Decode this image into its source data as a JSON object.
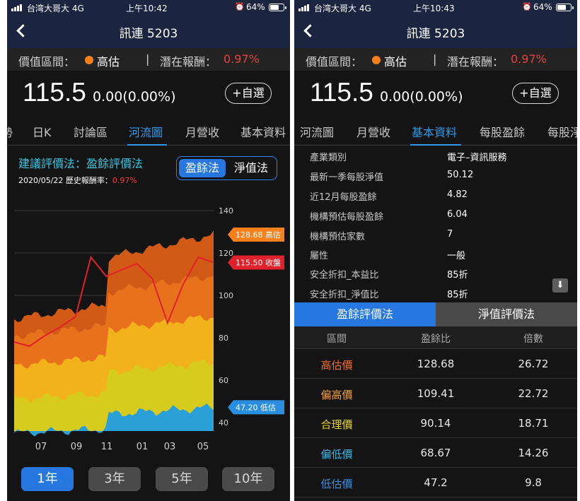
{
  "left": {
    "status": {
      "carrier": "台湾大哥大  4G",
      "time": "上午10:42",
      "battery": "64%"
    },
    "title": "訊連 5203",
    "valuation": {
      "label": "價值區間：",
      "status": "高估",
      "sep": "|",
      "potential_label": "潛在報酬：",
      "potential_value": "0.97%"
    },
    "price": "115.5",
    "change": "0.00(0.00%)",
    "fav_label": "+自選",
    "tabs": [
      "勢",
      "日K",
      "討論區",
      "河流圖",
      "月營收",
      "基本資料"
    ],
    "active_tab": "河流圖",
    "rec_label": "建議評價法：盈餘評價法",
    "rec_date": "2020/05/22 歷史報酬率：",
    "rec_rate": "0.97%",
    "seg": [
      "盈餘法",
      "淨值法"
    ],
    "range_buttons": [
      "1年",
      "3年",
      "5年",
      "10年"
    ],
    "active_range": "1年"
  },
  "chart_data": {
    "type": "area",
    "x_ticks": [
      "07",
      "09",
      "11",
      "01",
      "03",
      "05"
    ],
    "y_ticks": [
      "140",
      "120",
      "100",
      "80",
      "60",
      "40"
    ],
    "ylim": [
      36,
      140
    ],
    "grid": true,
    "bands": [
      {
        "name": "低估價",
        "color": "#2a9fd8",
        "start": 35.0,
        "end": 47.2
      },
      {
        "name": "偏低價",
        "color": "#d7cb1e",
        "start": 51.0,
        "end": 68.67
      },
      {
        "name": "合理價",
        "color": "#f2b21b",
        "start": 67.0,
        "end": 90.14
      },
      {
        "name": "偏高價",
        "color": "#e8721c",
        "start": 81.0,
        "end": 109.41
      },
      {
        "name": "高估價",
        "color": "#d25a17",
        "start": 89.0,
        "end": 128.68
      }
    ],
    "close_series": {
      "name": "收盤",
      "color": "#e0202a",
      "y": [
        78,
        76,
        81,
        85,
        90,
        118,
        109,
        112,
        115,
        108,
        87,
        105,
        118,
        115.5
      ]
    },
    "labels": [
      {
        "text": "128.68 高估",
        "value": 128.68,
        "color": "#f7801a"
      },
      {
        "text": "115.50 收盤",
        "value": 115.5,
        "color": "#e0202a"
      },
      {
        "text": "47.20 低估",
        "value": 47.2,
        "color": "#2a8ee0"
      }
    ]
  },
  "right": {
    "status": {
      "carrier": "台湾大哥大  4G",
      "time": "上午10:43",
      "battery": "64%"
    },
    "title": "訊連 5203",
    "valuation": {
      "label": "價值區間：",
      "status": "高估",
      "sep": "|",
      "potential_label": "潛在報酬：",
      "potential_value": "0.97%"
    },
    "price": "115.5",
    "change": "0.00(0.00%)",
    "fav_label": "+自選",
    "tabs": [
      "河流圖",
      "月營收",
      "基本資料",
      "每股盈餘",
      "每股淨"
    ],
    "active_tab": "基本資料",
    "details": [
      {
        "k": "產業類別",
        "v": "電子–資訊服務"
      },
      {
        "k": "最新一季每股淨值",
        "v": "50.12"
      },
      {
        "k": "近12月每股盈餘",
        "v": "4.82"
      },
      {
        "k": "機構預估每股盈餘",
        "v": "6.04"
      },
      {
        "k": "機構預估家數",
        "v": "7"
      },
      {
        "k": "屬性",
        "v": "一般"
      },
      {
        "k": "安全折扣_本益比",
        "v": "85折"
      },
      {
        "k": "安全折扣_淨值比",
        "v": "85折"
      }
    ],
    "method_tabs": [
      "盈餘評價法",
      "淨值評價法"
    ],
    "table_head": [
      "區間",
      "盈餘比",
      "倍數"
    ],
    "table_rows": [
      {
        "name": "高估價",
        "color": "#f36b2a",
        "eps": "128.68",
        "mult": "26.72"
      },
      {
        "name": "偏高價",
        "color": "#f3a23a",
        "eps": "109.41",
        "mult": "22.72"
      },
      {
        "name": "合理價",
        "color": "#e8d82a",
        "eps": "90.14",
        "mult": "18.71"
      },
      {
        "name": "偏低價",
        "color": "#3ab8e0",
        "eps": "68.67",
        "mult": "14.26"
      },
      {
        "name": "低估價",
        "color": "#3a8ee8",
        "eps": "47.2",
        "mult": "9.8"
      }
    ]
  }
}
